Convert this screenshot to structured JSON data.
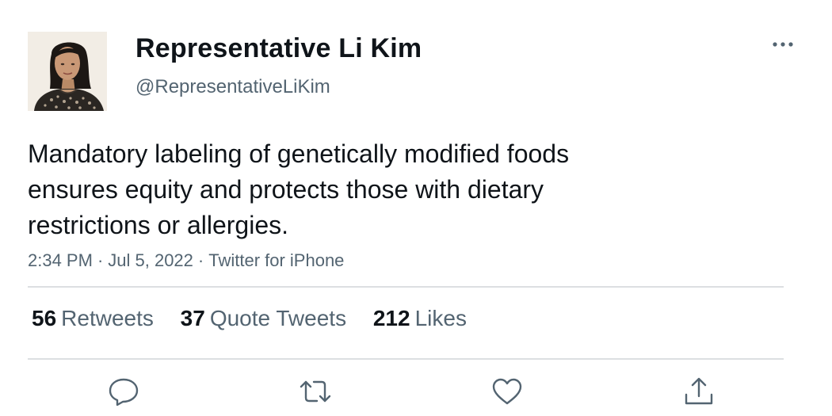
{
  "author": {
    "display_name": "Representative Li Kim",
    "handle": "@RepresentativeLiKim",
    "avatar_icon": "profile-photo"
  },
  "tweet": {
    "text": "Mandatory labeling of genetically modified foods ensures equity and protects those with dietary restrictions or allergies.",
    "time": "2:34 PM",
    "date": "Jul 5, 2022",
    "source": "Twitter for iPhone",
    "separator": "·"
  },
  "stats": {
    "retweets": {
      "count": "56",
      "label": "Retweets"
    },
    "quotes": {
      "count": "37",
      "label": "Quote Tweets"
    },
    "likes": {
      "count": "212",
      "label": "Likes"
    }
  },
  "icons": {
    "more": "more-horizontal-icon",
    "reply": "reply-icon",
    "retweet": "retweet-icon",
    "like": "heart-icon",
    "share": "share-icon"
  },
  "colors": {
    "text_primary": "#0f1419",
    "text_secondary": "#536471",
    "divider": "#dcdfe2",
    "icon": "#536471"
  }
}
